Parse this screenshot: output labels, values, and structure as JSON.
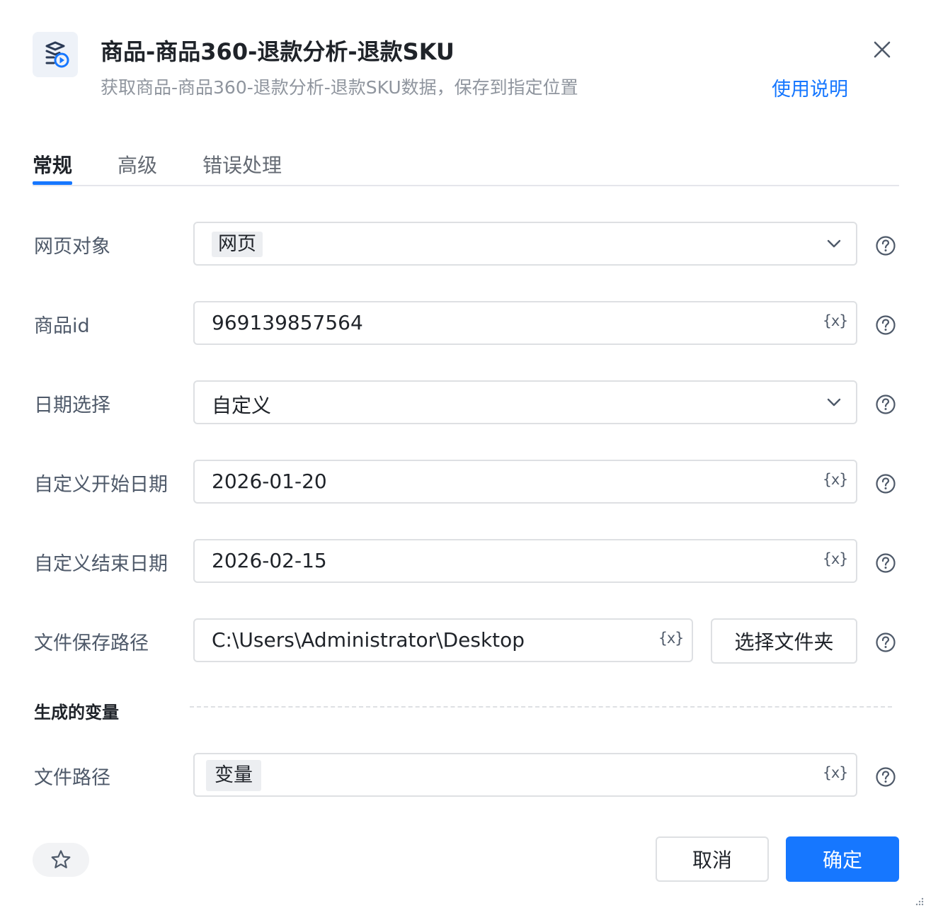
{
  "header": {
    "icon": "data-extract-icon",
    "title": "商品-商品360-退款分析-退款SKU",
    "subtitle": "获取商品-商品360-退款分析-退款SKU数据，保存到指定位置",
    "help_link": "使用说明",
    "close_icon": "close-icon"
  },
  "tabs": [
    {
      "label": "常规",
      "active": true
    },
    {
      "label": "高级",
      "active": false
    },
    {
      "label": "错误处理",
      "active": false
    }
  ],
  "fields": {
    "web_object": {
      "label": "网页对象",
      "value": "网页",
      "control": "select"
    },
    "product_id": {
      "label": "商品id",
      "value": "969139857564",
      "control": "text"
    },
    "date_select": {
      "label": "日期选择",
      "value": "自定义",
      "control": "select"
    },
    "start_date": {
      "label": "自定义开始日期",
      "value": "2026-01-20",
      "control": "text"
    },
    "end_date": {
      "label": "自定义结束日期",
      "value": "2026-02-15",
      "control": "text"
    },
    "save_path": {
      "label": "文件保存路径",
      "value": "C:\\Users\\Administrator\\Desktop",
      "control": "text",
      "button": "选择文件夹"
    }
  },
  "variable_button": "{x}",
  "output_section": {
    "title": "生成的变量",
    "file_path": {
      "label": "文件路径",
      "value": "变量"
    }
  },
  "footer": {
    "favorite_icon": "star-icon",
    "cancel": "取消",
    "confirm": "确定"
  },
  "colors": {
    "accent": "#1677ff",
    "border": "#dee0e3",
    "chip_bg": "#eceef1",
    "label": "#4e5969",
    "muted": "#8f959e"
  }
}
